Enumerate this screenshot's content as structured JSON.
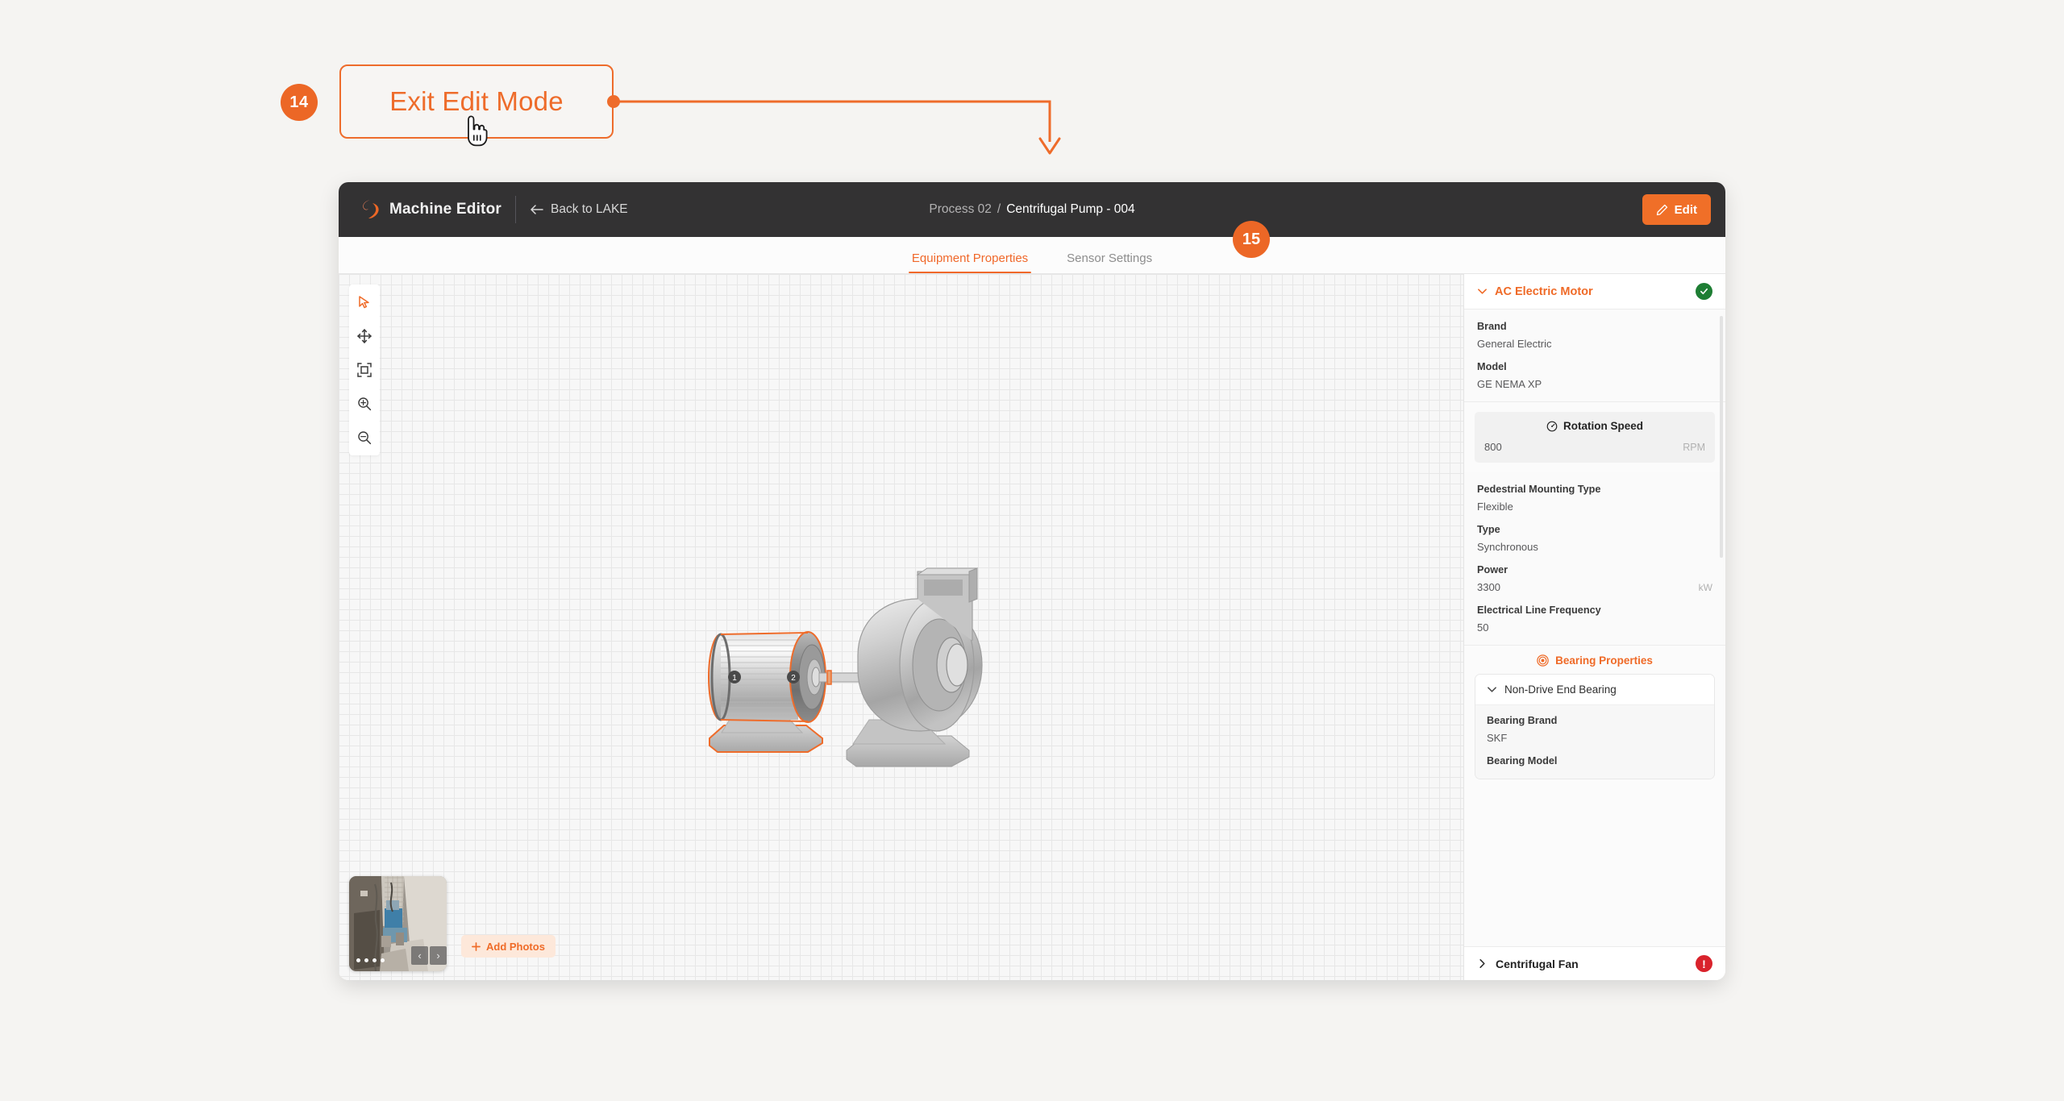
{
  "callout": {
    "step_number": "14",
    "label": "Exit Edit Mode"
  },
  "step_badge_right": {
    "step_number": "15"
  },
  "header": {
    "brand": "Machine Editor",
    "back_label": "Back to LAKE",
    "breadcrumb_parent": "Process 02",
    "breadcrumb_separator": "/",
    "breadcrumb_current": "Centrifugal Pump - 004",
    "edit_button": "Edit",
    "bg_color": "#333233"
  },
  "tabs": [
    {
      "label": "Equipment Properties",
      "active": true
    },
    {
      "label": "Sensor Settings",
      "active": false
    }
  ],
  "toolbar": {
    "tools": [
      {
        "name": "select-cursor-icon",
        "active": true
      },
      {
        "name": "pan-move-icon",
        "active": false
      },
      {
        "name": "fit-to-screen-icon",
        "active": false
      },
      {
        "name": "zoom-in-icon",
        "active": false
      },
      {
        "name": "zoom-out-icon",
        "active": false
      }
    ]
  },
  "canvas": {
    "machine_markers": [
      "1",
      "2"
    ],
    "selected_component": "AC Electric Motor"
  },
  "photos": {
    "dot_count": 4,
    "active_dot": 1,
    "prev_label": "‹",
    "next_label": "›",
    "add_photos_label": "Add Photos",
    "add_icon": "plus-icon"
  },
  "properties_panel": {
    "section": {
      "title": "AC Electric Motor",
      "status": "ok",
      "expanded": true
    },
    "fields": [
      {
        "label": "Brand",
        "value": "General Electric",
        "unit": ""
      },
      {
        "label": "Model",
        "value": "GE NEMA XP",
        "unit": ""
      }
    ],
    "metric": {
      "icon": "gauge-icon",
      "title": "Rotation Speed",
      "value": "800",
      "unit": "RPM"
    },
    "fields2": [
      {
        "label": "Pedestrial Mounting Type",
        "value": "Flexible",
        "unit": ""
      },
      {
        "label": "Type",
        "value": "Synchronous",
        "unit": ""
      },
      {
        "label": "Power",
        "value": "3300",
        "unit": "kW"
      },
      {
        "label": "Electrical Line Frequency",
        "value": "50",
        "unit": ""
      }
    ],
    "bearing": {
      "header": "Bearing Properties",
      "header_icon": "bearing-icon",
      "card_title": "Non-Drive End Bearing",
      "fields": [
        {
          "label": "Bearing Brand",
          "value": "SKF"
        },
        {
          "label": "Bearing Model",
          "value": ""
        }
      ]
    },
    "footer_section": {
      "title": "Centrifugal Fan",
      "status": "error",
      "expanded": false
    }
  },
  "colors": {
    "accent": "#ef6a27",
    "accent_strong": "#ec6726",
    "header_bg": "#333233",
    "ok_green": "#1e7e34",
    "error_red": "#d9232c",
    "page_bg": "#f5f4f2"
  }
}
